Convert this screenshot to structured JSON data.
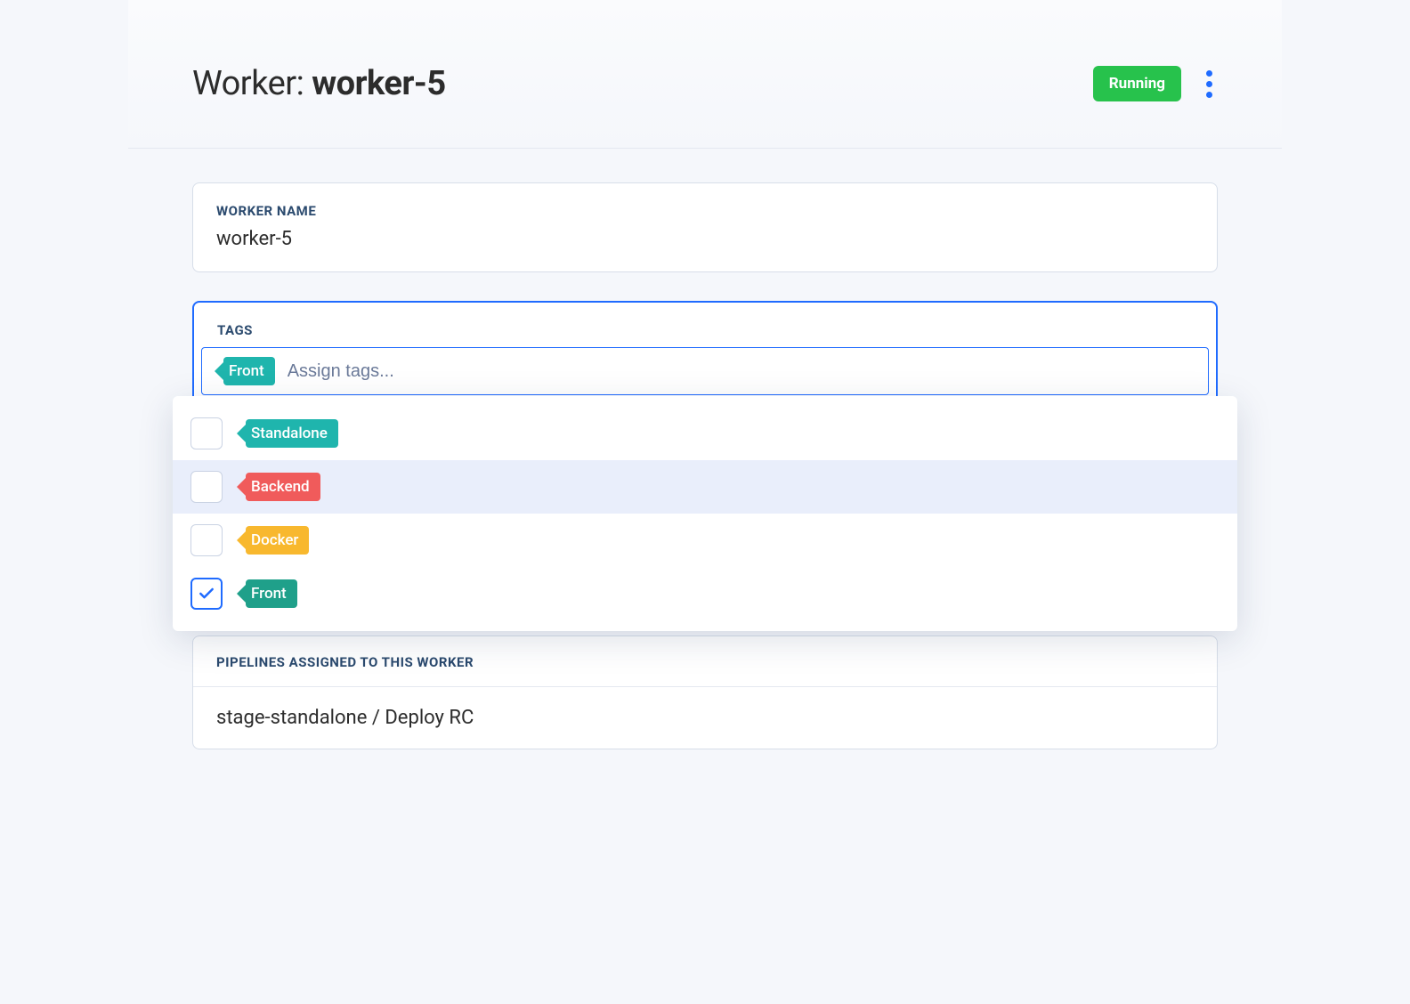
{
  "header": {
    "title_prefix": "Worker: ",
    "title_name": "worker-5",
    "status": "Running",
    "more_icon": "more-vertical"
  },
  "worker_name": {
    "label": "WORKER NAME",
    "value": "worker-5"
  },
  "tags": {
    "label": "TAGS",
    "placeholder": "Assign tags...",
    "selected": [
      {
        "label": "Front",
        "color": "teal"
      }
    ],
    "options": [
      {
        "label": "Standalone",
        "color": "teal",
        "checked": false,
        "hover": false
      },
      {
        "label": "Backend",
        "color": "red",
        "checked": false,
        "hover": true
      },
      {
        "label": "Docker",
        "color": "amber",
        "checked": false,
        "hover": false
      },
      {
        "label": "Front",
        "color": "green",
        "checked": true,
        "hover": false
      }
    ]
  },
  "pipelines": {
    "label": "PIPELINES ASSIGNED TO THIS WORKER",
    "items": [
      "stage-standalone / Deploy RC"
    ]
  }
}
